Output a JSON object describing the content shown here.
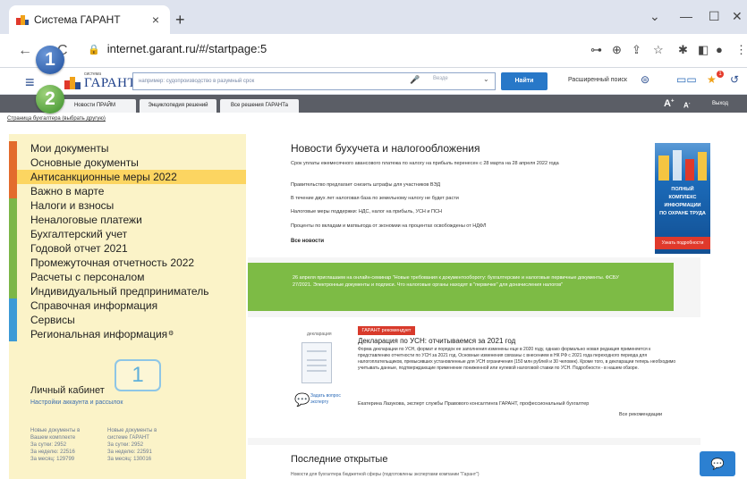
{
  "browser": {
    "tab_title": "Система ГАРАНТ",
    "tab_close": "×",
    "new_tab": "+",
    "url": "internet.garant.ru/#/startpage:5",
    "back": "←",
    "reload": "C",
    "window_controls": {
      "dropdown": "⌄",
      "minimize": "—",
      "maximize": "☐",
      "close": "✕"
    },
    "addr_icons": {
      "key": "⊶",
      "zoom": "⊕",
      "share": "⇪",
      "star": "☆",
      "extensions": "✱",
      "sidepanel": "◧",
      "profile": "●",
      "menu": "⋮"
    }
  },
  "header": {
    "menu_icon": "≡",
    "logo_small": "система",
    "logo_name": "ГАРАНТ",
    "search_placeholder": "например: судопроизводство в разумный срок",
    "mic_icon": "🎤",
    "scope": "Везде",
    "scope_chevron": "⌄",
    "find_button": "Найти",
    "advanced_search": "Расширенный поиск",
    "advanced_icon": "⊜",
    "badge_count": "1"
  },
  "nav": {
    "tabs": [
      "Новости ПРАЙМ",
      "Энциклопедия решений",
      "Все решения ГАРАНТа"
    ],
    "font_large": "A",
    "font_small": "A",
    "font_plus": "+",
    "font_minus": "-",
    "exit": "Выход"
  },
  "breadcrumb": "Страница бухгалтера (выбрать другую)",
  "sidebar": {
    "items": [
      {
        "label": "Мои документы",
        "color": "#e36b2c"
      },
      {
        "label": "Основные документы",
        "color": "#e36b2c"
      },
      {
        "label": "Антисанкционные меры 2022",
        "color": "#e36b2c",
        "active": true
      },
      {
        "label": "Важно в марте",
        "color": "#e36b2c"
      },
      {
        "label": "Налоги и взносы",
        "color": "#7cb648"
      },
      {
        "label": "Неналоговые платежи",
        "color": "#7cb648"
      },
      {
        "label": "Бухгалтерский учет",
        "color": "#7cb648"
      },
      {
        "label": "Годовой отчет 2021",
        "color": "#7cb648"
      },
      {
        "label": "Промежуточная отчетность 2022",
        "color": "#7cb648"
      },
      {
        "label": "Расчеты с персоналом",
        "color": "#7cb648"
      },
      {
        "label": "Индивидуальный предприниматель",
        "color": "#7cb648"
      },
      {
        "label": "Справочная информация",
        "color": "#3c9ad6"
      },
      {
        "label": "Сервисы",
        "color": "#3c9ad6"
      },
      {
        "label": "Региональная информация",
        "color": "#3c9ad6",
        "gear": "⚙"
      }
    ],
    "cabinet_title": "Личный кабинет",
    "cabinet_link": "Настройки аккаунта и рассылок",
    "stats_left": [
      "Новые документы в",
      "Вашем комплекте",
      "За сутки: 2952",
      "За неделю: 22516",
      "За месяц: 129799"
    ],
    "stats_right": [
      "Новые документы в",
      "системе ГАРАНТ",
      "За сутки: 2952",
      "За неделю: 22591",
      "За месяц: 130016"
    ]
  },
  "callouts": {
    "circle_1": "1",
    "circle_2": "2",
    "box_1": "1"
  },
  "news": {
    "title": "Новости бухучета и налогообложения",
    "items": [
      "Срок уплаты ежемесячного авансового платежа по налогу на прибыль перенесен с 28 марта на 28 апреля 2022 года",
      "Правительство предлагает снизить штрафы для участников ВЭД",
      "В течение двух лет налоговая база по земельному налогу не будет расти",
      "Налоговые меры поддержки: НДС, налог на прибыль, УСН и ПСН",
      "Проценты по вкладам и матвыгода от экономии на процентах освобождены от НДФЛ"
    ],
    "all": "Все новости"
  },
  "promo": {
    "lines": [
      "ПОЛНЫЙ",
      "КОМПЛЕКС",
      "ИНФОРМАЦИИ",
      "ПО ОХРАНЕ ТРУДА"
    ],
    "more": "Узнать подробности"
  },
  "green_band": "26 апреля приглашаем на онлайн-семинар \"Новые требования к документообороту: бухгалтерские и налоговые первичные документы. ФСБУ 27/2021. Электронные документы и подписи. Что налоговые органы находят в \"первичке\" для доначисления налогов\"",
  "recommend": {
    "doc_label": "декларация",
    "ask_icon": "💬",
    "ask": [
      "Задать вопрос",
      "эксперту"
    ],
    "badge": "ГАРАНТ рекомендует",
    "title": "Декларация по УСН: отчитываемся за 2021 год",
    "body": "Форма декларации по УСН, формат и порядок ее заполнения изменены еще в 2020 году, однако формально новая редакция применяется к представлению отчетности по УСН за 2021 год. Основные изменения связаны с внесением в НК РФ с 2021 года переходного периода для налогоплательщиков, превысивших установленные для УСН ограничения (150 млн рублей и 30 человек). Кроме того, в декларации теперь необходимо учитывать данные, подтверждающие применение пониженной или нулевой налоговой ставки по УСН. Подробности - в нашем обзоре.",
    "author": "Екатерина Лазукова, эксперт службы Правового консалтинга ГАРАНТ, профессиональный бухгалтер",
    "all": "Все рекомендации"
  },
  "last_opened": {
    "title": "Последние открытые",
    "sub": "Новости для бухгалтера бюджетной сферы (подготовлены экспертами компании \"Гарант\")"
  },
  "chat_icon": "💬"
}
